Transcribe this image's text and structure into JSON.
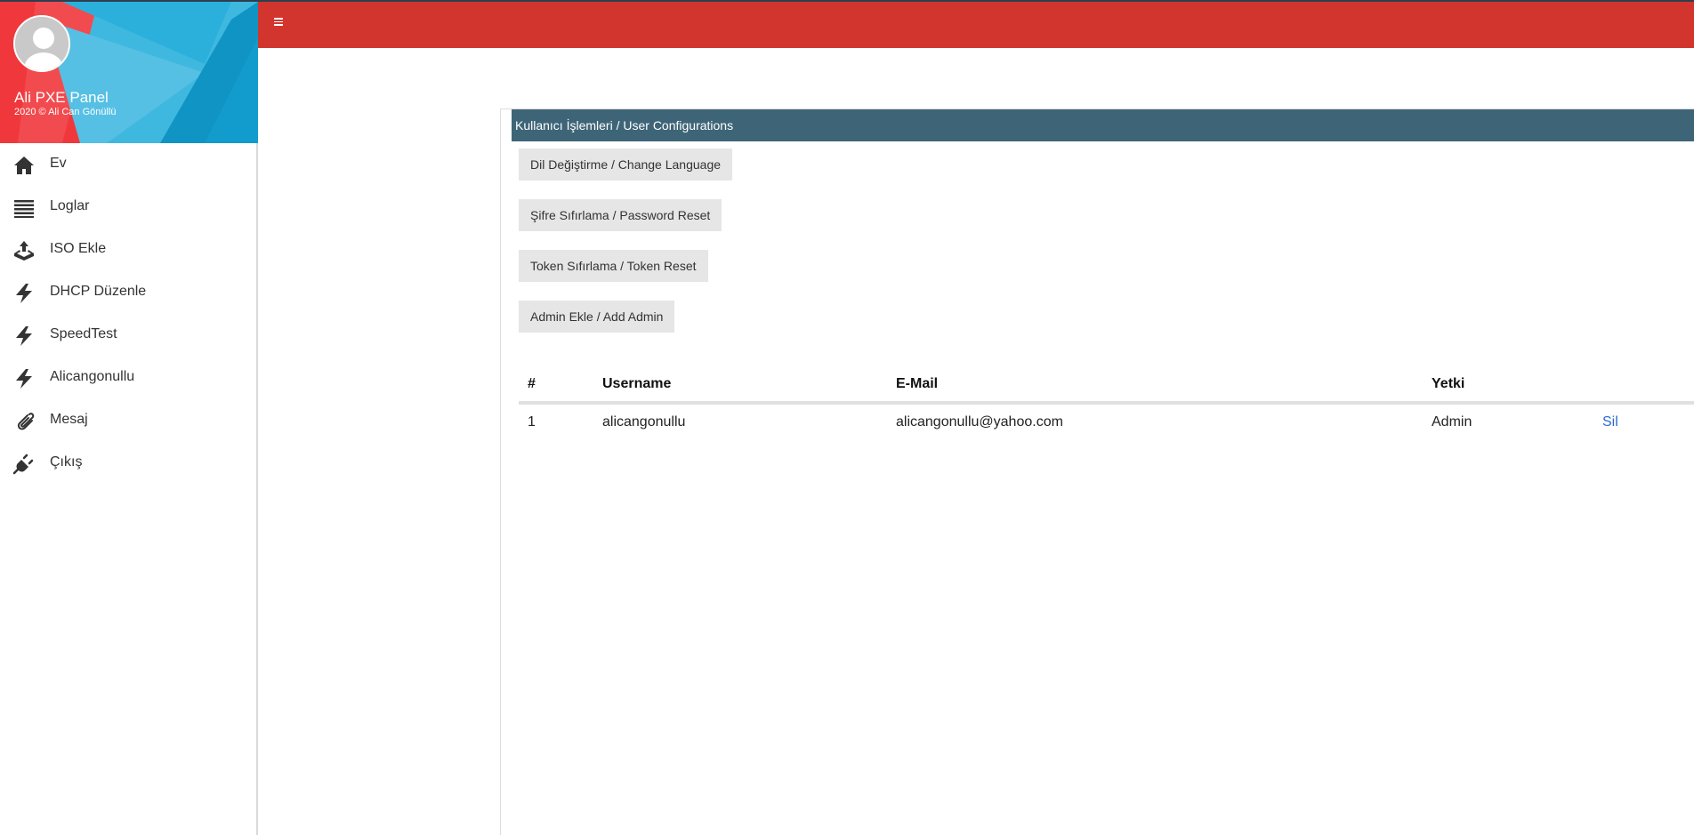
{
  "sidebar": {
    "title": "Ali PXE Panel",
    "subtitle": "2020 © Ali Can Gönüllü",
    "items": [
      {
        "label": "Ev",
        "icon": "home-icon"
      },
      {
        "label": "Loglar",
        "icon": "list-icon"
      },
      {
        "label": "ISO Ekle",
        "icon": "upload-icon"
      },
      {
        "label": "DHCP Düzenle",
        "icon": "bolt-icon"
      },
      {
        "label": "SpeedTest",
        "icon": "bolt-icon"
      },
      {
        "label": "Alicangonullu",
        "icon": "bolt-icon"
      },
      {
        "label": "Mesaj",
        "icon": "paperclip-icon"
      },
      {
        "label": "Çıkış",
        "icon": "plug-icon"
      }
    ]
  },
  "topbar": {
    "menu_icon": "hamburger-icon"
  },
  "card": {
    "header": "Kullanıcı İşlemleri / User Configurations",
    "buttons": {
      "change_language": "Dil Değiştirme / Change Language",
      "password_reset": "Şifre Sıfırlama / Password Reset",
      "token_reset": "Token Sıfırlama / Token Reset",
      "add_admin": "Admin Ekle / Add Admin"
    }
  },
  "table": {
    "columns": [
      "#",
      "Username",
      "E-Mail",
      "Yetki",
      ""
    ],
    "rows": [
      {
        "id": "1",
        "username": "alicangonullu",
        "email": "alicangonullu@yahoo.com",
        "role": "Admin",
        "action": "Sil"
      }
    ]
  },
  "colors": {
    "topbar": "#d2352d",
    "card_header": "#3e6577",
    "role": "#1f8a1f",
    "link": "#2a6bd1"
  }
}
